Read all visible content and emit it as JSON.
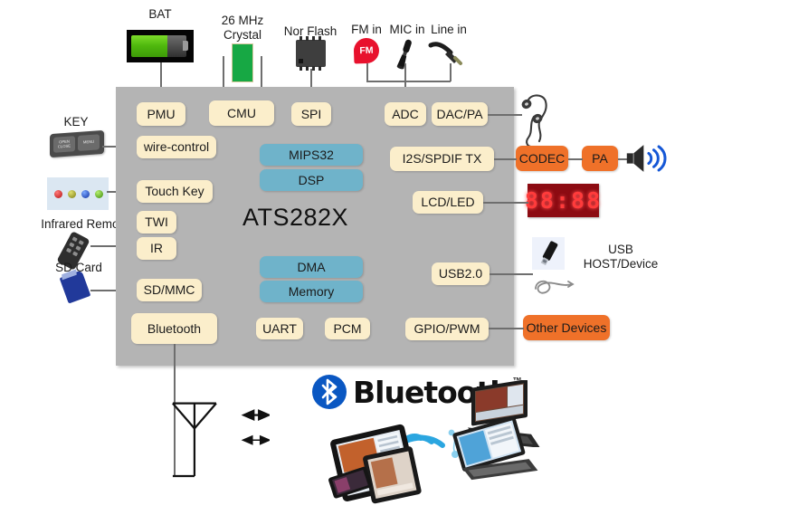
{
  "diagram": {
    "title": "ATS282X",
    "chip_label": "ATS282X"
  },
  "top_peripherals": [
    {
      "name": "bat",
      "label": "BAT",
      "icon": "battery-icon"
    },
    {
      "name": "crystal",
      "label": "26 MHz\nCrystal",
      "icon": "crystal-icon"
    },
    {
      "name": "norflash",
      "label": "Nor Flash",
      "icon": "ic-chip-icon"
    },
    {
      "name": "fmin",
      "label": "FM in",
      "icon": "fm-radio-icon"
    },
    {
      "name": "micin",
      "label": "MIC in",
      "icon": "microphone-icon"
    },
    {
      "name": "linein",
      "label": "Line in",
      "icon": "audio-cable-icon"
    }
  ],
  "left_peripherals": [
    {
      "name": "key",
      "label": "KEY",
      "icon": "key-panel-icon",
      "sub": {
        "btn1": "OPEN\nCLOSE",
        "btn2": "MENU"
      }
    },
    {
      "name": "touch-pad",
      "label": "",
      "icon": "touch-pad-icon"
    },
    {
      "name": "infrared",
      "label": "Infrared Remote",
      "icon": "ir-remote-icon"
    },
    {
      "name": "sdcard",
      "label": "SD Card",
      "icon": "sd-card-icon"
    }
  ],
  "chip_blocks": {
    "cream": [
      {
        "name": "pmu",
        "label": "PMU"
      },
      {
        "name": "cmu",
        "label": "CMU"
      },
      {
        "name": "spi",
        "label": "SPI"
      },
      {
        "name": "adc",
        "label": "ADC"
      },
      {
        "name": "dac-pa",
        "label": "DAC/PA"
      },
      {
        "name": "wire-control",
        "label": "wire-control"
      },
      {
        "name": "i2s-spdif-tx",
        "label": "I2S/SPDIF TX"
      },
      {
        "name": "touch-key",
        "label": "Touch Key"
      },
      {
        "name": "lcd-led",
        "label": "LCD/LED"
      },
      {
        "name": "twi",
        "label": "TWI"
      },
      {
        "name": "ir",
        "label": "IR"
      },
      {
        "name": "usb20",
        "label": "USB2.0"
      },
      {
        "name": "sd-mmc",
        "label": "SD/MMC"
      },
      {
        "name": "bluetooth",
        "label": "Bluetooth"
      },
      {
        "name": "uart",
        "label": "UART"
      },
      {
        "name": "pcm",
        "label": "PCM"
      },
      {
        "name": "gpio-pwm",
        "label": "GPIO/PWM"
      }
    ],
    "blue": [
      {
        "name": "mips32",
        "label": "MIPS32"
      },
      {
        "name": "dsp",
        "label": "DSP"
      },
      {
        "name": "dma",
        "label": "DMA"
      },
      {
        "name": "memory",
        "label": "Memory"
      }
    ]
  },
  "right_peripherals": [
    {
      "name": "earphone",
      "label": "",
      "icon": "earphone-icon"
    },
    {
      "name": "codec",
      "label": "CODEC",
      "icon": ""
    },
    {
      "name": "pa",
      "label": "PA",
      "icon": ""
    },
    {
      "name": "speaker",
      "label": "",
      "icon": "speaker-icon"
    },
    {
      "name": "led-display",
      "label": "88:88",
      "icon": "seven-segment-display-icon"
    },
    {
      "name": "usb-device",
      "label": "USB\nHOST/Device",
      "icon": "usb-stick-icon"
    },
    {
      "name": "usb-cable",
      "label": "",
      "icon": "usb-cable-icon"
    },
    {
      "name": "other-devices",
      "label": "Other Devices",
      "icon": ""
    }
  ],
  "bottom": {
    "bluetooth_wordmark": "Bluetooth",
    "bluetooth_tm": "™",
    "antenna_icon": "antenna-icon",
    "arrow_icon": "double-arrow-icon",
    "devices": [
      "laptop",
      "tablet-convertible",
      "tablet-large",
      "tablet-small",
      "smartphone"
    ]
  },
  "colors": {
    "chip_gray": "#b4b4b4",
    "cream": "#fbeecb",
    "blue": "#6fb3ca",
    "orange": "#ef7129",
    "bt_blue": "#0a57c2",
    "led_red": "#ff3b3b",
    "led_bg": "#8c0b12",
    "battery_green": "#4fb80d",
    "crystal_green": "#17a844",
    "fm_red": "#e8112d",
    "sd_blue": "#21399a",
    "line_gray": "#6e6e6e"
  }
}
